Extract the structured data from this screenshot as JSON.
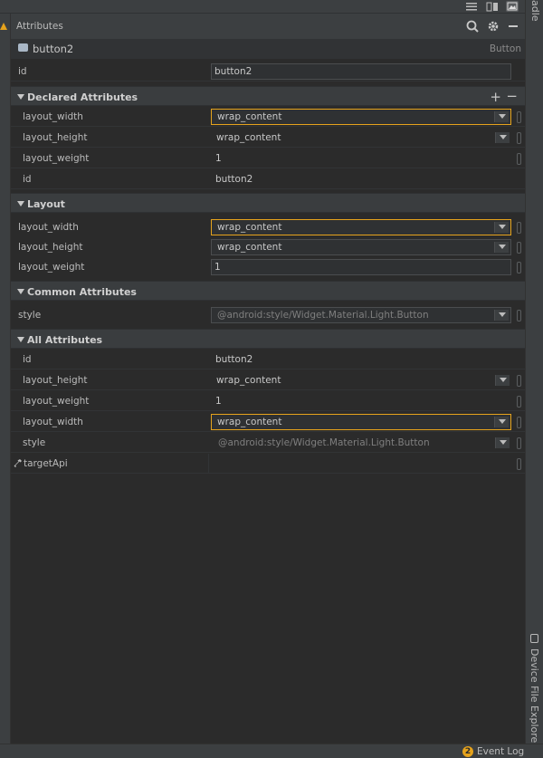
{
  "topbar": {
    "icons": [
      "list-icon",
      "columns-icon",
      "image-icon"
    ]
  },
  "right_strip": {
    "top_label": "adle",
    "bottom_label": "Device File Explorer"
  },
  "bottombar": {
    "badge": "2",
    "event_log": "Event Log"
  },
  "panel": {
    "title": "Attributes",
    "component": {
      "name": "button2",
      "type": "Button"
    },
    "id_row": {
      "label": "id",
      "value": "button2"
    },
    "sections": {
      "declared": {
        "name": "Declared Attributes",
        "plus": "+",
        "minus": "−"
      },
      "layout": {
        "name": "Layout"
      },
      "common": {
        "name": "Common Attributes"
      },
      "all": {
        "name": "All Attributes"
      }
    },
    "declared_rows": [
      {
        "label": "layout_width",
        "value": "wrap_content"
      },
      {
        "label": "layout_height",
        "value": "wrap_content"
      },
      {
        "label": "layout_weight",
        "value": "1"
      },
      {
        "label": "id",
        "value": "button2"
      }
    ],
    "layout_rows": [
      {
        "label": "layout_width",
        "value": "wrap_content"
      },
      {
        "label": "layout_height",
        "value": "wrap_content"
      },
      {
        "label": "layout_weight",
        "value": "1"
      }
    ],
    "common_rows": [
      {
        "label": "style",
        "value": "@android:style/Widget.Material.Light.Button"
      }
    ],
    "all_rows": [
      {
        "label": "id",
        "value": "button2"
      },
      {
        "label": "layout_height",
        "value": "wrap_content"
      },
      {
        "label": "layout_weight",
        "value": "1"
      },
      {
        "label": "layout_width",
        "value": "wrap_content"
      },
      {
        "label": "style",
        "value": "@android:style/Widget.Material.Light.Button"
      },
      {
        "label": "targetApi",
        "value": ""
      }
    ]
  },
  "colors": {
    "accent": "#e6a31c",
    "background": "#2b2b2b",
    "header": "#3c3f41"
  }
}
